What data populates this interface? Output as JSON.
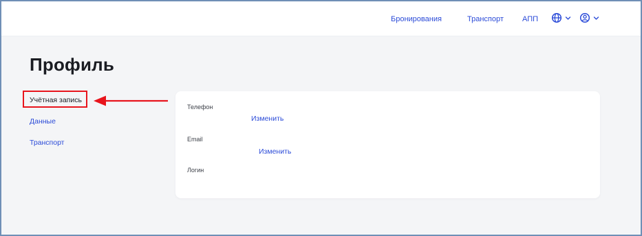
{
  "header": {
    "nav": [
      {
        "label": "Бронирования"
      },
      {
        "label": "Транспорт"
      },
      {
        "label": "АПП"
      }
    ],
    "language_icon": "globe-icon",
    "account_icon": "user-circle-icon",
    "dropdown_icon": "chevron-down-icon"
  },
  "page": {
    "title": "Профиль"
  },
  "sidebar": {
    "items": [
      {
        "label": "Учётная запись",
        "active": true
      },
      {
        "label": "Данные"
      },
      {
        "label": "Транспорт"
      }
    ]
  },
  "annotation": {
    "highlight_color": "#e8141c",
    "arrow_icon": "left-arrow-icon"
  },
  "card": {
    "fields": [
      {
        "label": "Телефон",
        "action": "Изменить"
      },
      {
        "label": "Email",
        "action": "Изменить"
      },
      {
        "label": "Логин"
      }
    ]
  },
  "colors": {
    "accent": "#2b4bd8",
    "background": "#f4f5f7",
    "text": "#1a1c22"
  }
}
